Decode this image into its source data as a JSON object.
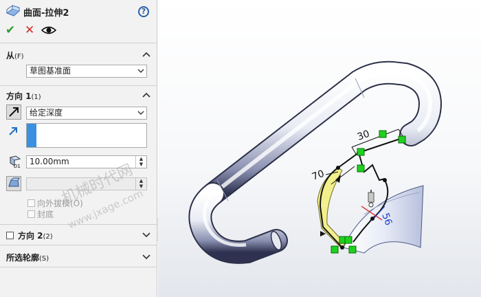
{
  "feature": {
    "title": "曲面-拉伸2",
    "help_glyph": "?",
    "ok_glyph": "✔",
    "cancel_glyph": "✕"
  },
  "from_section": {
    "header": "从",
    "shortcut": "(F)",
    "select_value": "草图基准面"
  },
  "direction1": {
    "header": "方向 1",
    "shortcut": "(1)",
    "end_condition": "给定深度",
    "depth": "10.00mm",
    "draft_value": "",
    "draft_outward_label": "向外拔模(O)",
    "cap_end_label": "封底"
  },
  "direction2": {
    "header": "方向 2",
    "shortcut": "(2)"
  },
  "contours": {
    "header": "所选轮廓",
    "shortcut": "(S)"
  },
  "watermark": {
    "line1": "机械时代网",
    "line2": "www.jxage.com"
  },
  "viewport": {
    "dim_30": "30",
    "dim_70": "70",
    "dim_56": "56",
    "depth_marker": "D1"
  },
  "colors": {
    "accent_blue": "#3b90e0",
    "relation_green": "#1fd11f",
    "sketch_black": "#111111",
    "surface_yellow": "#f2ef8c",
    "dim_blue": "#1f3fcc"
  },
  "icons": [
    "surface-extrude-icon",
    "help-icon",
    "ok-icon",
    "cancel-icon",
    "preview-eye-icon",
    "chevron-up-icon",
    "chevron-down-icon",
    "direction-arrow-icon",
    "reverse-direction-icon",
    "depth-icon",
    "draft-icon"
  ]
}
